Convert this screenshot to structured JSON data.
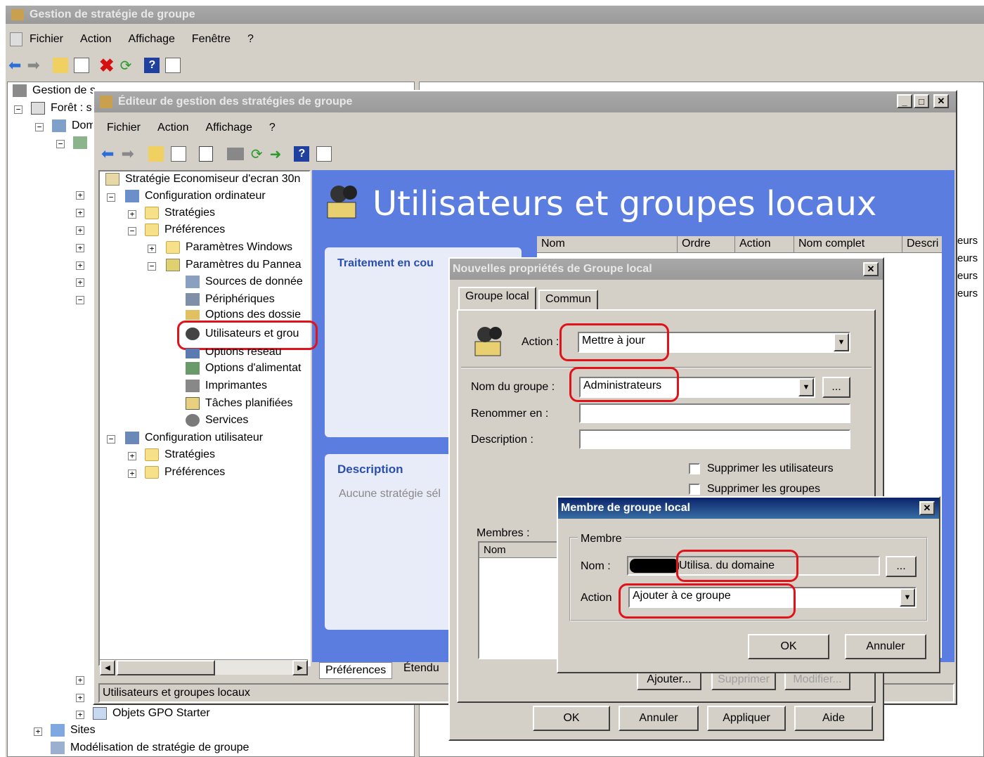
{
  "main_window": {
    "title": "Gestion de stratégie de groupe",
    "menu": [
      "Fichier",
      "Action",
      "Affichage",
      "Fenêtre",
      "?"
    ],
    "tree": {
      "root": "Gestion de s",
      "forest": "Forêt : s",
      "domain": "Dom",
      "gpo_starter": "Objets GPO Starter",
      "sites": "Sites",
      "modeling": "Modélisation de stratégie de groupe"
    },
    "right_edge_items": [
      "eurs",
      "eurs",
      "eurs",
      "eurs"
    ]
  },
  "editor_window": {
    "title": "Éditeur de gestion des stratégies de groupe",
    "menu": [
      "Fichier",
      "Action",
      "Affichage",
      "?"
    ],
    "tree": {
      "root": "Stratégie Economiseur d'ecran 30n",
      "computer_config": "Configuration ordinateur",
      "strategies": "Stratégies",
      "preferences": "Préférences",
      "windows_params": "Paramètres Windows",
      "panel_params": "Paramètres du Pannea",
      "data_sources": "Sources de donnée",
      "devices": "Périphériques",
      "folder_options": "Options des dossie",
      "local_users": "Utilisateurs et grou",
      "network_options": "Options réseau",
      "power_options": "Options d'alimentat",
      "printers": "Imprimantes",
      "scheduled_tasks": "Tâches planifiées",
      "services": "Services",
      "user_config": "Configuration utilisateur",
      "user_strategies": "Stratégies",
      "user_preferences": "Préférences"
    },
    "header_title": "Utilisateurs et groupes locaux",
    "columns": [
      "Nom",
      "Ordre",
      "Action",
      "Nom complet",
      "Descri"
    ],
    "processing_label": "Traitement en cou",
    "description_label": "Description",
    "description_text": "Aucune stratégie sél",
    "tabs": [
      "Préférences",
      "Étendu"
    ],
    "status": "Utilisateurs et groupes locaux"
  },
  "group_dialog": {
    "title": "Nouvelles propriétés de Groupe local",
    "tabs": [
      "Groupe local",
      "Commun"
    ],
    "action_label": "Action :",
    "action_value": "Mettre à jour",
    "group_name_label": "Nom du groupe :",
    "group_name_value": "Administrateurs",
    "rename_label": "Renommer en :",
    "description_label": "Description :",
    "delete_users": "Supprimer les utilisateurs",
    "delete_groups": "Supprimer les groupes",
    "members_label": "Membres :",
    "members_column": "Nom",
    "btn_add": "Ajouter...",
    "btn_remove": "Supprimer",
    "btn_modify": "Modifier...",
    "btn_ok": "OK",
    "btn_cancel": "Annuler",
    "btn_apply": "Appliquer",
    "btn_help": "Aide",
    "browse": "..."
  },
  "member_dialog": {
    "title": "Membre de groupe local",
    "group_label": "Membre",
    "name_label": "Nom :",
    "name_value": "Utilisa. du domaine",
    "action_label": "Action",
    "action_value": "Ajouter à ce groupe",
    "btn_ok": "OK",
    "btn_cancel": "Annuler",
    "browse": "..."
  },
  "colors": {
    "highlight_ring": "#e0121a",
    "panel_blue": "#5b7de0",
    "face": "#d4d0c8"
  }
}
